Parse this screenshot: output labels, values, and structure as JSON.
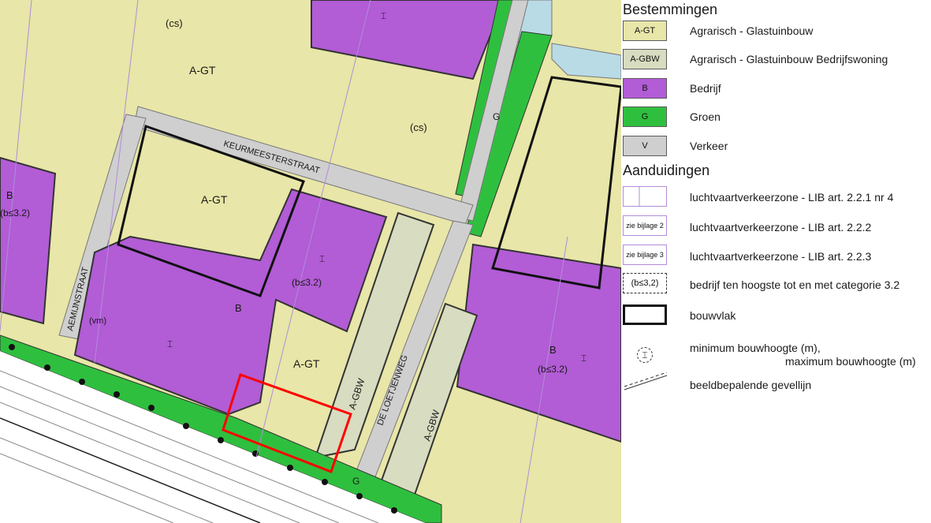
{
  "map": {
    "labels": {
      "agt_1": "A-GT",
      "agt_2": "A-GT",
      "agt_3": "A-GT",
      "cs_1": "(cs)",
      "cs_2": "(cs)",
      "b_west": "B",
      "b_west_cat": "(b≤3.2)",
      "b_center": "B",
      "b_center_cat": "(b≤3.2)",
      "b_east": "B",
      "b_east_cat": "(b≤3.2)",
      "agbw_1": "A-GBW",
      "agbw_2": "A-GBW",
      "street_keurmeester": "KEURMEESTERSTRAAT",
      "street_aemi": "AEMIJNSTRAAT",
      "street_loetje": "DE LOETJENWEG",
      "groen_1": "G",
      "groen_2": "G",
      "vm": "(vm)",
      "height_glyph": "⌶"
    },
    "colors": {
      "agrarisch": "#e8e6a8",
      "bedrijf": "#b25cd6",
      "groen": "#2fbf3f",
      "verkeer": "#cfcfcf",
      "water": "#b9dbe6",
      "selection": "#ff0000"
    }
  },
  "legend": {
    "bestemmingen_title": "Bestemmingen",
    "aanduidingen_title": "Aanduidingen",
    "bestemmingen": [
      {
        "code": "A-GT",
        "label": "Agrarisch - Glastuinbouw",
        "color": "#e8e6a8"
      },
      {
        "code": "A-GBW",
        "label": "Agrarisch - Glastuinbouw Bedrijfswoning",
        "color": "#d8dcc0"
      },
      {
        "code": "B",
        "label": "Bedrijf",
        "color": "#b25cd6"
      },
      {
        "code": "G",
        "label": "Groen",
        "color": "#2fbf3f"
      },
      {
        "code": "V",
        "label": "Verkeer",
        "color": "#cfcfcf"
      }
    ],
    "aanduidingen": [
      {
        "code": "",
        "label": "luchtvaartverkeerzone - LIB art. 2.2.1 nr 4"
      },
      {
        "code": "zie bijlage 2",
        "label": "luchtvaartverkeerzone - LIB art. 2.2.2"
      },
      {
        "code": "zie bijlage 3",
        "label": "luchtvaartverkeerzone - LIB art. 2.2.3"
      },
      {
        "code": "(b≤3,2)",
        "label": "bedrijf ten hoogste tot en met categorie 3.2"
      },
      {
        "code": "",
        "label": "bouwvlak"
      },
      {
        "code": "",
        "label_line1": "minimum bouwhoogte (m),",
        "label_line2": "maximum bouwhoogte (m)"
      },
      {
        "code": "",
        "label": "beeldbepalende gevellijn"
      }
    ]
  }
}
